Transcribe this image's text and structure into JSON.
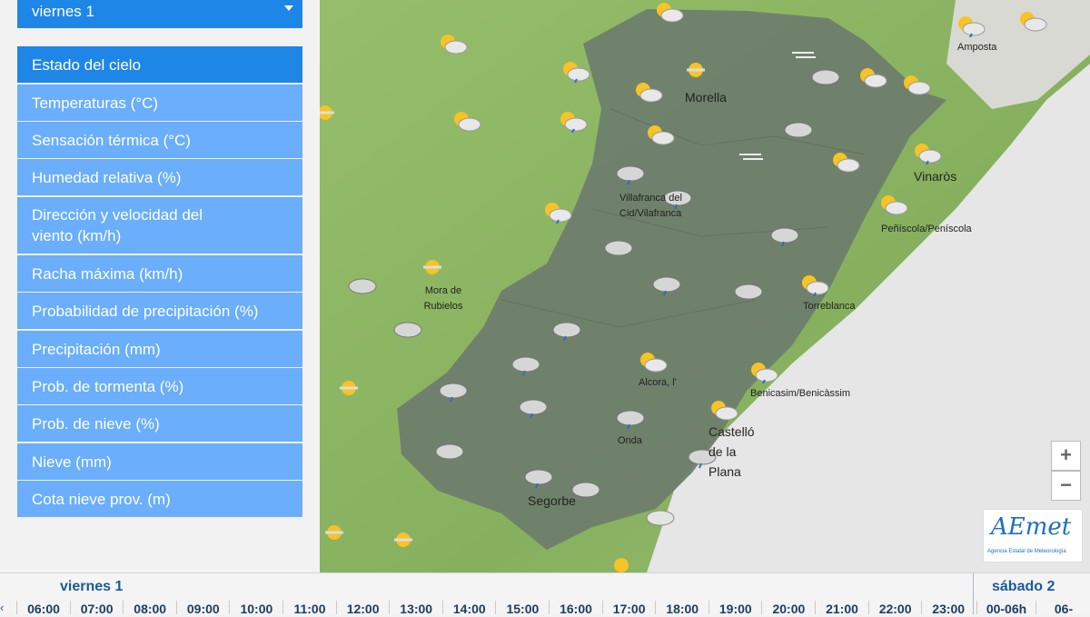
{
  "day_selector": {
    "value": "viernes 1"
  },
  "menu": [
    {
      "label": "Estado del cielo",
      "active": true
    },
    {
      "label": "Temperaturas (°C)"
    },
    {
      "label": "Sensación térmica (°C)"
    },
    {
      "label": "Humedad relativa (%)"
    },
    {
      "label": "Dirección y velocidad del viento (km/h)"
    },
    {
      "label": "Racha máxima (km/h)"
    },
    {
      "label": "Probabilidad de precipitación (%)"
    },
    {
      "label": "Precipitación (mm)"
    },
    {
      "label": "Prob. de tormenta (%)"
    },
    {
      "label": "Prob. de nieve (%)"
    },
    {
      "label": "Nieve (mm)"
    },
    {
      "label": "Cota nieve prov. (m)"
    }
  ],
  "map": {
    "towns": [
      "Morella",
      "Vinaròs",
      "Amposta",
      "Villafranca del Cid/Vilafranca",
      "Peñíscola/Peníscola",
      "Mora de Rubielos",
      "Torreblanca",
      "Alcora, l'",
      "Benicasim/Benicàssim",
      "Onda",
      "Castelló de la Plana",
      "Segorbe"
    ],
    "zoom_in": "+",
    "zoom_out": "−",
    "logo_text": "AEmet",
    "logo_subtitle": "Agencia Estatal de Meteorología"
  },
  "timeline": {
    "day1": "viernes 1",
    "day2": "sábado 2",
    "hours": [
      "06:00",
      "07:00",
      "08:00",
      "09:00",
      "10:00",
      "11:00",
      "12:00",
      "13:00",
      "14:00",
      "15:00",
      "16:00",
      "17:00",
      "18:00",
      "19:00",
      "20:00",
      "21:00",
      "22:00",
      "23:00"
    ],
    "next_slots": [
      "00-06h",
      "06-"
    ]
  },
  "colors": {
    "accent": "#1e86e6",
    "menu": "#6aaefc",
    "region": "#6d7d6c",
    "land": "#8db664",
    "sea": "#e5e5e5"
  }
}
